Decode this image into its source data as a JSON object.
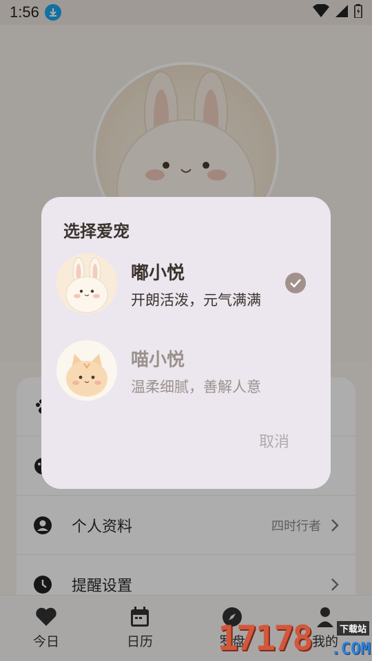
{
  "status_bar": {
    "time": "1:56"
  },
  "background": {
    "menu_items": [
      {
        "label": "",
        "value": ""
      },
      {
        "label": "",
        "value": ""
      },
      {
        "label": "个人资料",
        "value": "四时行者"
      },
      {
        "label": "提醒设置",
        "value": ""
      }
    ],
    "tabs": [
      {
        "label": "今日",
        "icon": "heart-icon"
      },
      {
        "label": "日历",
        "icon": "calendar-icon"
      },
      {
        "label": "罗盘",
        "icon": "compass-icon"
      },
      {
        "label": "我的",
        "icon": "person-icon"
      }
    ]
  },
  "dialog": {
    "title": "选择爱宠",
    "pets": [
      {
        "name": "嘟小悦",
        "desc": "开朗活泼，元气满满",
        "selected": true,
        "icon": "bunny-avatar-icon"
      },
      {
        "name": "喵小悦",
        "desc": "温柔细腻，善解人意",
        "selected": false,
        "icon": "cat-avatar-icon"
      }
    ],
    "cancel_label": "取消"
  },
  "watermark": {
    "digits": "17178",
    "tag": "下载站",
    "domain": ".COM"
  },
  "colors": {
    "accent_check": "#a1918d",
    "dialog_bg": "#ece7ee",
    "status_download": "#1aa7ec"
  }
}
